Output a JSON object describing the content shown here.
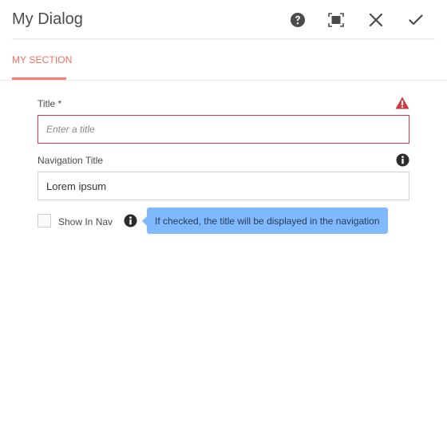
{
  "dialog": {
    "title": "My Dialog",
    "actions": [
      {
        "name": "help",
        "icon": "help-icon",
        "label": "Help"
      },
      {
        "name": "fullscreen",
        "icon": "fullscreen-icon",
        "label": "Toggle fullscreen"
      },
      {
        "name": "close",
        "icon": "close-icon",
        "label": "Cancel"
      },
      {
        "name": "done",
        "icon": "checkmark-icon",
        "label": "Done"
      }
    ]
  },
  "tabs": [
    {
      "label": "MY SECTION",
      "active": true
    }
  ],
  "form": {
    "title_field": {
      "label": "Title *",
      "value": "",
      "placeholder": "Enter a title",
      "status_icon": "alert-icon",
      "status_color": "#d7373f"
    },
    "nav_title_field": {
      "label": "Navigation Title",
      "value": "Lorem ipsum",
      "info_icon": "info-icon"
    },
    "show_in_nav": {
      "label": "Show In Nav",
      "checked": false,
      "info_icon": "info-icon",
      "tooltip": "If checked, the title will be displayed in the navigation"
    }
  },
  "colors": {
    "accent": "#f26f61",
    "error": "#d7373f",
    "tooltip_bg": "#80b9fd"
  }
}
